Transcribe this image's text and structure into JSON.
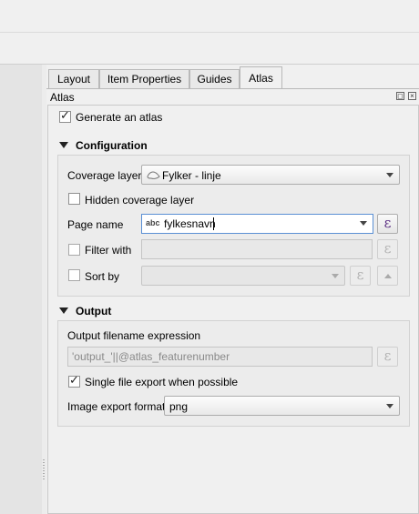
{
  "tabs": [
    {
      "label": "Layout"
    },
    {
      "label": "Item Properties"
    },
    {
      "label": "Guides"
    },
    {
      "label": "Atlas",
      "active": true
    }
  ],
  "panel": {
    "title": "Atlas"
  },
  "generate_atlas": {
    "label": "Generate an atlas",
    "checked": true
  },
  "configuration": {
    "title": "Configuration",
    "coverage_layer": {
      "label": "Coverage layer",
      "value": "Fylker - linje",
      "icon": "line-layer-icon"
    },
    "hidden_coverage": {
      "label": "Hidden coverage layer",
      "checked": false
    },
    "page_name": {
      "label": "Page name",
      "value": "fylkesnavn",
      "type_badge": "abc"
    },
    "filter_with": {
      "label": "Filter with",
      "checked": false,
      "value": ""
    },
    "sort_by": {
      "label": "Sort by",
      "checked": false,
      "value": ""
    }
  },
  "output": {
    "title": "Output",
    "filename_label": "Output filename expression",
    "filename_value": "'output_'||@atlas_featurenumber",
    "single_file": {
      "label": "Single file export when possible",
      "checked": true
    },
    "image_format": {
      "label": "Image export format",
      "value": "png"
    }
  },
  "expression_symbol": "ε",
  "colors": {
    "expression_button": "#5a2d82",
    "focus_border": "#5a8fd4"
  }
}
